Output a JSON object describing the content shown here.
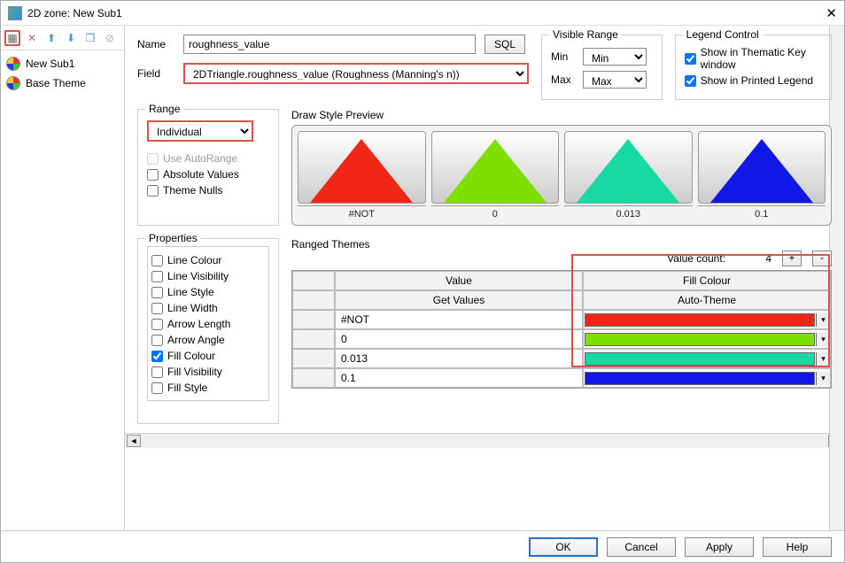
{
  "window": {
    "title": "2D zone: New Sub1"
  },
  "toolbar_icons": [
    "add",
    "delete",
    "up",
    "down",
    "copy",
    "disable"
  ],
  "tree": {
    "items": [
      {
        "label": "New Sub1"
      },
      {
        "label": "Base Theme"
      }
    ]
  },
  "form": {
    "name_label": "Name",
    "name_value": "roughness_value",
    "sql_label": "SQL",
    "field_label": "Field",
    "field_value": "2DTriangle.roughness_value (Roughness (Manning's n))"
  },
  "visible_range": {
    "title": "Visible Range",
    "min_label": "Min",
    "min_value": "Min",
    "max_label": "Max",
    "max_value": "Max"
  },
  "legend_control": {
    "title": "Legend Control",
    "show_key": "Show in Thematic Key window",
    "show_printed": "Show in Printed Legend"
  },
  "range": {
    "title": "Range",
    "mode": "Individual",
    "use_autorange": "Use AutoRange",
    "absolute": "Absolute Values",
    "theme_nulls": "Theme Nulls"
  },
  "preview": {
    "title": "Draw Style Preview",
    "items": [
      {
        "label": "#NOT",
        "color": "#f02616"
      },
      {
        "label": "0",
        "color": "#7fe000"
      },
      {
        "label": "0.013",
        "color": "#17d9a2"
      },
      {
        "label": "0.1",
        "color": "#1018e8"
      }
    ]
  },
  "properties": {
    "title": "Properties",
    "items": [
      {
        "label": "Line Colour",
        "checked": false
      },
      {
        "label": "Line Visibility",
        "checked": false
      },
      {
        "label": "Line Style",
        "checked": false
      },
      {
        "label": "Line Width",
        "checked": false
      },
      {
        "label": "Arrow Length",
        "checked": false
      },
      {
        "label": "Arrow Angle",
        "checked": false
      },
      {
        "label": "Fill Colour",
        "checked": true
      },
      {
        "label": "Fill Visibility",
        "checked": false
      },
      {
        "label": "Fill Style",
        "checked": false
      }
    ]
  },
  "ranged": {
    "title": "Ranged Themes",
    "value_count_label": "Value count:",
    "value_count": "4",
    "plus": "+",
    "minus": "-",
    "col_value": "Value",
    "col_fill": "Fill Colour",
    "btn_get": "Get Values",
    "btn_auto": "Auto-Theme",
    "rows": [
      {
        "value": "#NOT",
        "color": "#f02616"
      },
      {
        "value": "0",
        "color": "#7fe000"
      },
      {
        "value": "0.013",
        "color": "#17d9a2"
      },
      {
        "value": "0.1",
        "color": "#1018e8"
      }
    ]
  },
  "footer": {
    "ok": "OK",
    "cancel": "Cancel",
    "apply": "Apply",
    "help": "Help"
  }
}
